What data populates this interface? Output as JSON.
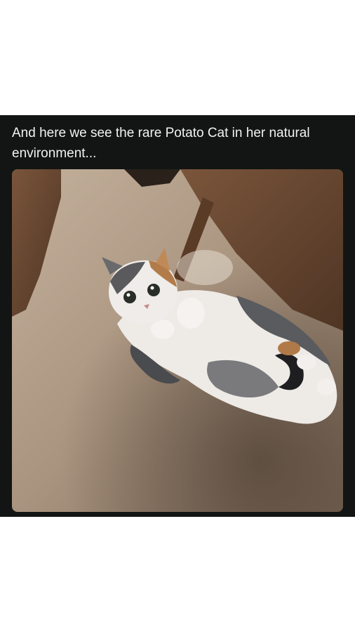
{
  "post": {
    "caption": "And here we see the rare Potato Cat in her natural environment...",
    "image": {
      "subject": "calico-cat",
      "colors": {
        "carpet": "#a9947f",
        "carpet_shadow": "#6e5c4d",
        "furniture": "#6b4a33",
        "background": "#121513"
      }
    }
  }
}
